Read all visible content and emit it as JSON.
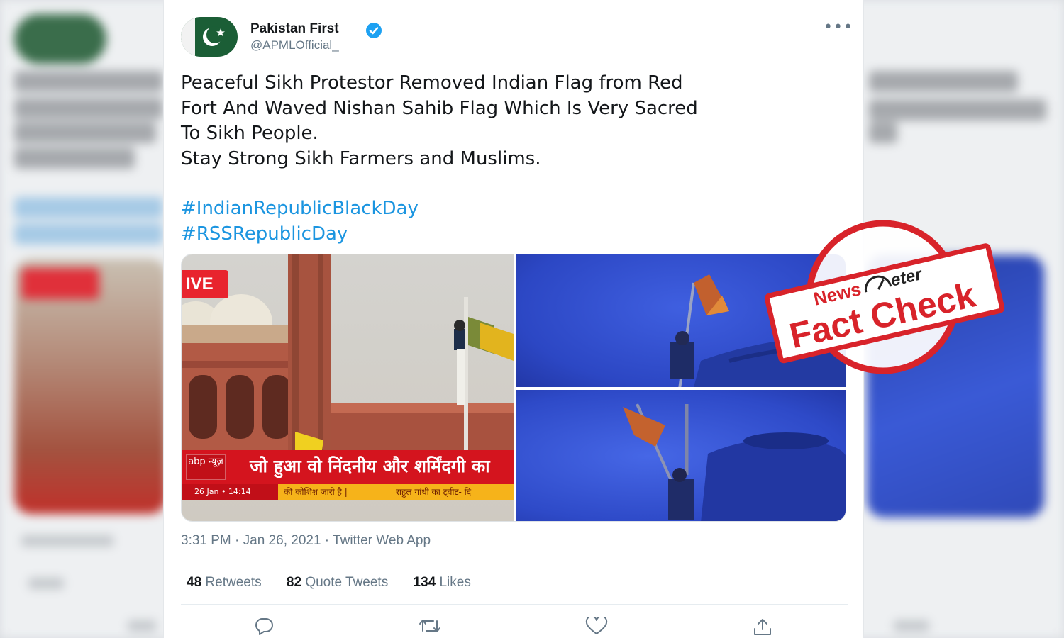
{
  "tweet": {
    "display_name": "Pakistan First",
    "handle": "@APMLOfficial_",
    "more_label": "•••",
    "body_lines": [
      "Peaceful Sikh Protestor Removed Indian Flag from Red",
      "Fort And Waved Nishan Sahib Flag Which Is Very Sacred",
      "To Sikh People.",
      "Stay Strong Sikh Farmers and Muslims."
    ],
    "hashtags": [
      "#IndianRepublicBlackDay",
      "#RSSRepublicDay"
    ],
    "media": {
      "live_badge": "IVE",
      "channel_logo": "abp न्यूज़",
      "headline": "जो हुआ वो निंदनीय और शर्मिंदगी का",
      "ticker_date": "26 Jan • 14:14",
      "ticker_text_1": "की कोशिश जारी है |",
      "ticker_text_2": "राहुल गांधी का ट्वीट- दि"
    },
    "timestamp": "3:31 PM · Jan 26, 2021 · Twitter Web App",
    "stats": {
      "retweets_count": "48",
      "retweets_label": "Retweets",
      "quotes_count": "82",
      "quotes_label": "Quote Tweets",
      "likes_count": "134",
      "likes_label": "Likes"
    }
  },
  "stamp": {
    "brand_left": "News",
    "brand_right": "eter",
    "label": "Fact Check",
    "color": "#d8232a"
  },
  "colors": {
    "link": "#1b95e0",
    "secondary": "#657786",
    "verified": "#1da1f2"
  },
  "icons": [
    "reply-icon",
    "retweet-icon",
    "like-icon",
    "share-icon",
    "verified-badge-icon",
    "more-icon"
  ]
}
